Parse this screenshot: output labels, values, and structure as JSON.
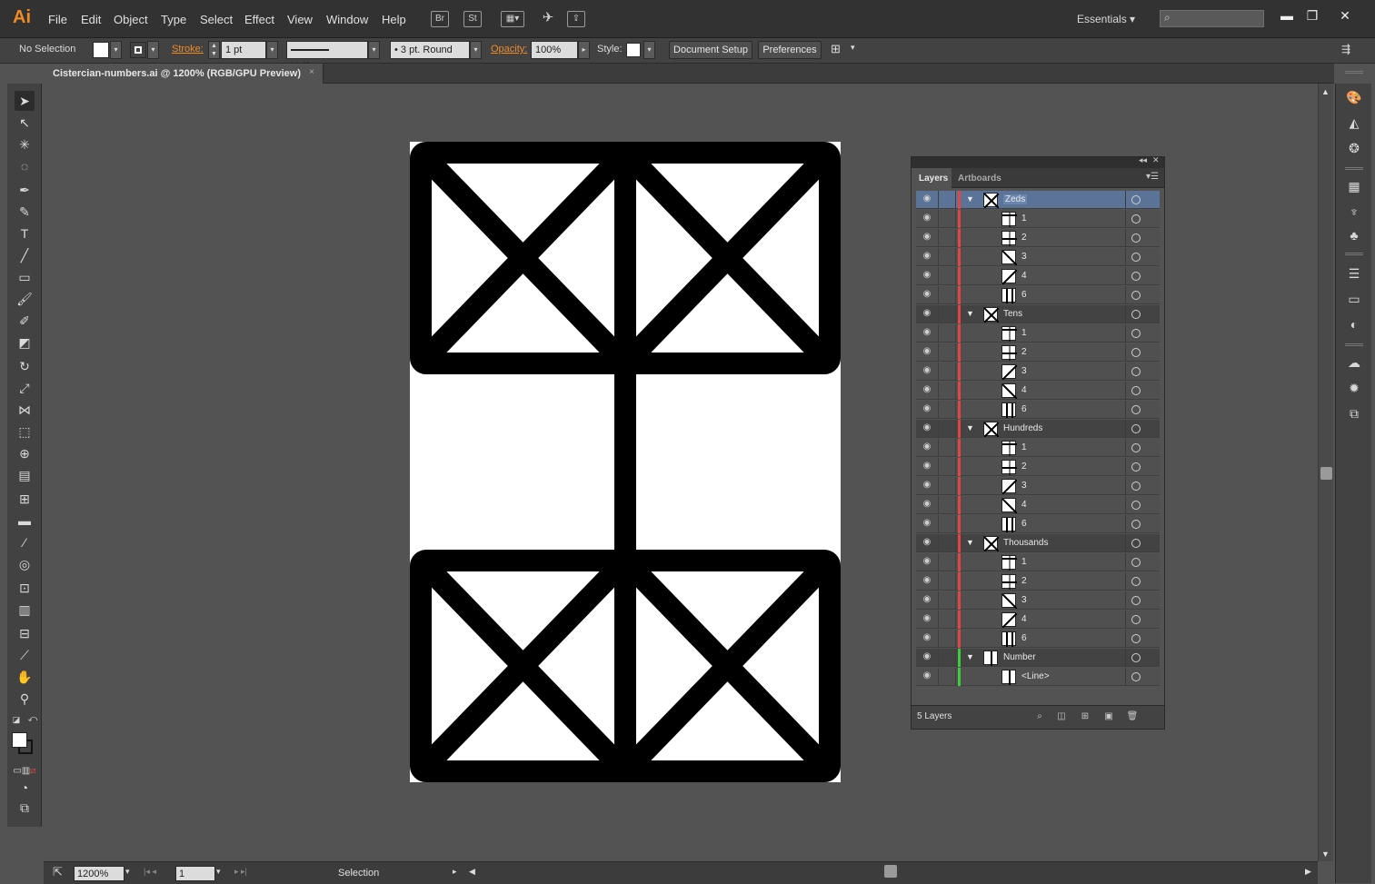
{
  "app": {
    "logo": "Ai"
  },
  "menu": [
    "File",
    "Edit",
    "Object",
    "Type",
    "Select",
    "Effect",
    "View",
    "Window",
    "Help"
  ],
  "menubar_icons": {
    "bridge": "Br",
    "stock": "St"
  },
  "workspace": "Essentials",
  "search": {
    "value": "",
    "placeholder": ""
  },
  "control_bar": {
    "selection": "No Selection",
    "stroke_label": "Stroke:",
    "stroke_weight": "1 pt",
    "stroke_profile": "Uniform",
    "brush": "3 pt. Round",
    "opacity_label": "Opacity:",
    "opacity": "100%",
    "style_label": "Style:",
    "document_setup": "Document Setup",
    "preferences": "Preferences"
  },
  "document": {
    "tab_title": "Cistercian-numbers.ai @ 1200% (RGB/GPU Preview)",
    "close": "×"
  },
  "status_bar": {
    "zoom": "1200%",
    "artboard": "1",
    "tool_status": "Selection"
  },
  "layers_panel": {
    "tabs": [
      "Layers",
      "Artboards"
    ],
    "layer_count": "5 Layers",
    "layers": [
      {
        "name": "Zeds",
        "color": "#e04646",
        "glyph": "x",
        "selected": true,
        "children": [
          {
            "name": "1",
            "glyph": "1"
          },
          {
            "name": "2",
            "glyph": "2"
          },
          {
            "name": "3",
            "glyph": "3"
          },
          {
            "name": "4",
            "glyph": "4"
          },
          {
            "name": "6",
            "glyph": "6"
          }
        ]
      },
      {
        "name": "Tens",
        "color": "#e04646",
        "glyph": "x",
        "children": [
          {
            "name": "1",
            "glyph": "1"
          },
          {
            "name": "2",
            "glyph": "2"
          },
          {
            "name": "3",
            "glyph": "4"
          },
          {
            "name": "4",
            "glyph": "3"
          },
          {
            "name": "6",
            "glyph": "6"
          }
        ]
      },
      {
        "name": "Hundreds",
        "color": "#e04646",
        "glyph": "x",
        "children": [
          {
            "name": "1",
            "glyph": "1"
          },
          {
            "name": "2",
            "glyph": "2"
          },
          {
            "name": "3",
            "glyph": "4"
          },
          {
            "name": "4",
            "glyph": "3"
          },
          {
            "name": "6",
            "glyph": "6"
          }
        ]
      },
      {
        "name": "Thousands",
        "color": "#e04646",
        "glyph": "x",
        "children": [
          {
            "name": "1",
            "glyph": "1"
          },
          {
            "name": "2",
            "glyph": "2"
          },
          {
            "name": "3",
            "glyph": "3"
          },
          {
            "name": "4",
            "glyph": "4"
          },
          {
            "name": "6",
            "glyph": "6"
          }
        ]
      },
      {
        "name": "Number",
        "color": "#3ccc3c",
        "glyph": "line",
        "children": [
          {
            "name": "<Line>",
            "glyph": "line"
          }
        ]
      }
    ]
  }
}
